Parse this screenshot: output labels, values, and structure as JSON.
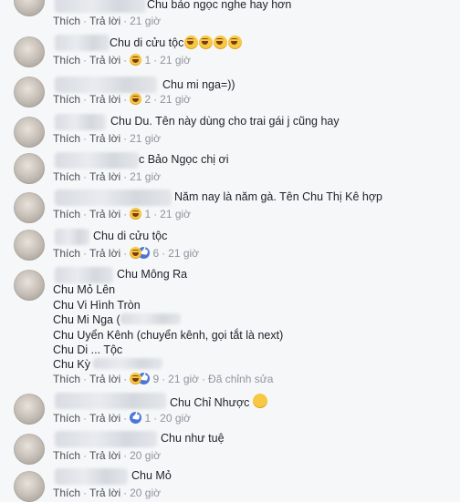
{
  "actions": {
    "like": "Thích",
    "reply": "Trả lời",
    "edited": "Đã chỉnh sửa"
  },
  "comments": [
    {
      "text": "Chu bảo ngọc nghe hay hơn",
      "time": "21 giờ"
    },
    {
      "text": "Chu di cửu tộc",
      "reactions": "1",
      "time": "21 giờ",
      "inline_emojis": [
        "laughing-emoji",
        "laughing-emoji",
        "laughing-emoji",
        "laughing-emoji"
      ]
    },
    {
      "text": "Chu mi nga=))",
      "reactions": "2",
      "time": "21 giờ"
    },
    {
      "text": "Chu Du. Tên này dùng cho trai gái j cũng hay",
      "time": "21 giờ"
    },
    {
      "text": "c Bảo Ngọc chị ơi",
      "time": "21 giờ"
    },
    {
      "text": "Năm nay là năm gà. Tên Chu Thị Kê hợp",
      "reactions": "1",
      "time": "21 giờ"
    },
    {
      "text": "Chu di cửu tộc",
      "reactions": "6",
      "time": "21 giờ"
    },
    {
      "text": "Chu Mông Ra",
      "lines": [
        "Chu Mỏ Lên",
        "Chu Vi Hình Tròn",
        "Chu Mi Nga (",
        "Chu Uyển Kênh (chuyển kênh, gọi tắt là next)",
        "Chu Di ... Tộc",
        "Chu Kỳ"
      ],
      "reactions": "9",
      "time": "21 giờ"
    },
    {
      "text": "Chu Chỉ Nhược",
      "reactions": "1",
      "time": "20 giờ"
    },
    {
      "text": "Chu như tuệ",
      "time": "20 giờ"
    },
    {
      "text": "Chu Mỏ",
      "time": "20 giờ"
    }
  ],
  "colors": {
    "background": "#f6f7f9",
    "link": "#4b4f56",
    "meta": "#90949c",
    "text": "#1d2129"
  }
}
